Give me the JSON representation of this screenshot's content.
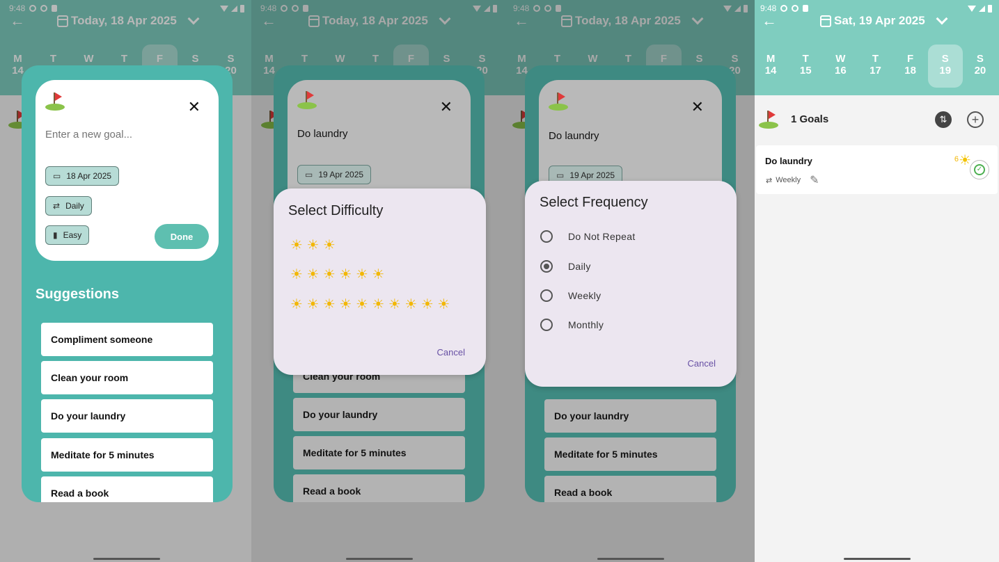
{
  "status": {
    "time": "9:48"
  },
  "panels": [
    {
      "header": {
        "title": "Today, 18 Apr 2025"
      },
      "week": [
        {
          "d": "M",
          "n": "14"
        },
        {
          "d": "T",
          "n": "15"
        },
        {
          "d": "W",
          "n": "16"
        },
        {
          "d": "T",
          "n": "17"
        },
        {
          "d": "F",
          "n": "18"
        },
        {
          "d": "S",
          "n": "19"
        },
        {
          "d": "S",
          "n": "20"
        }
      ],
      "goal_input": {
        "value": "",
        "placeholder": "Enter a new goal..."
      },
      "chips": {
        "date": "18 Apr 2025",
        "frequency": "Daily",
        "difficulty": "Easy"
      },
      "done_label": "Done",
      "suggestions_title": "Suggestions",
      "suggestions": [
        "Compliment someone",
        "Clean your room",
        "Do your laundry",
        "Meditate for 5 minutes",
        "Read a book"
      ]
    },
    {
      "header": {
        "title": "Today, 18 Apr 2025"
      },
      "goal_input": {
        "value": "Do laundry"
      },
      "chips": {
        "date": "19 Apr 2025"
      },
      "dialog": {
        "title": "Select Difficulty",
        "rows": [
          {
            "suns": "☀ ☀ ☀",
            "count": 3
          },
          {
            "suns": "☀ ☀ ☀ ☀ ☀ ☀",
            "count": 6
          },
          {
            "suns": "☀ ☀ ☀ ☀ ☀ ☀ ☀ ☀ ☀ ☀",
            "count": 10
          }
        ],
        "cancel": "Cancel"
      },
      "suggestions": [
        "Clean your room",
        "Do your laundry",
        "Meditate for 5 minutes",
        "Read a book"
      ]
    },
    {
      "header": {
        "title": "Today, 18 Apr 2025"
      },
      "goal_input": {
        "value": "Do laundry"
      },
      "chips": {
        "date": "19 Apr 2025"
      },
      "dialog": {
        "title": "Select Frequency",
        "options": [
          "Do Not Repeat",
          "Daily",
          "Weekly",
          "Monthly"
        ],
        "selected": "Daily",
        "cancel": "Cancel"
      },
      "suggestions": [
        "Do your laundry",
        "Meditate for 5 minutes",
        "Read a book"
      ]
    },
    {
      "header": {
        "title": "Sat, 19 Apr 2025"
      },
      "week": [
        {
          "d": "M",
          "n": "14"
        },
        {
          "d": "T",
          "n": "15"
        },
        {
          "d": "W",
          "n": "16"
        },
        {
          "d": "T",
          "n": "17"
        },
        {
          "d": "F",
          "n": "18"
        },
        {
          "d": "S",
          "n": "19"
        },
        {
          "d": "S",
          "n": "20"
        }
      ],
      "goals_count": "1 Goals",
      "goal": {
        "name": "Do laundry",
        "frequency": "Weekly",
        "points": "6"
      }
    }
  ],
  "colors": {
    "accent": "#7fcdbf",
    "sheet": "#4db6ac",
    "sun": "#f2b705",
    "dialog": "#ece6f0",
    "link": "#6750a4"
  },
  "icons": [
    "back-arrow-icon",
    "calendar-icon",
    "chevron-down-icon",
    "flag-icon",
    "close-icon",
    "repeat-icon",
    "bar-chart-icon",
    "sun-icon",
    "radio-icon",
    "sort-icon",
    "add-icon",
    "pencil-icon",
    "check-icon"
  ]
}
